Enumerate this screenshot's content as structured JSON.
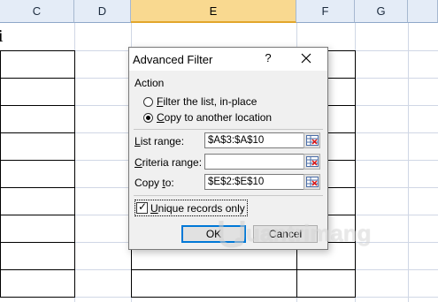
{
  "spreadsheet": {
    "columns": [
      {
        "label": "C",
        "selected": false
      },
      {
        "label": "D",
        "selected": false
      },
      {
        "label": "E",
        "selected": true
      },
      {
        "label": "F",
        "selected": false
      },
      {
        "label": "G",
        "selected": false
      },
      {
        "label": "",
        "selected": false
      }
    ],
    "partial_cell_text": "i"
  },
  "dialog": {
    "title": "Advanced Filter",
    "help_label": "?",
    "close_label": "✕",
    "action_group_label": "Action",
    "radio_filter_in_place": {
      "prefix": "",
      "mnemonic": "F",
      "rest": "ilter the list, in-place",
      "checked": false
    },
    "radio_copy_location": {
      "prefix": "",
      "mnemonic": "C",
      "rest": "opy to another location",
      "checked": true
    },
    "list_range": {
      "mnemonic": "L",
      "rest": "ist range:",
      "value": "$A$3:$A$10"
    },
    "criteria_range": {
      "mnemonic": "C",
      "rest": "riteria range:",
      "value": ""
    },
    "copy_to": {
      "prefix": "Copy ",
      "mnemonic": "t",
      "rest": "o:",
      "value": "$E$2:$E$10"
    },
    "unique_records": {
      "prefix": "",
      "mnemonic": "U",
      "rest": "nique records only",
      "checked": true
    },
    "ok_label": "OK",
    "cancel_label": "Cancel"
  },
  "watermark": {
    "text": "uantrimang"
  },
  "colors": {
    "accent": "#0078d7",
    "selected_header": "#f9d990",
    "header": "#e4ecf7"
  }
}
